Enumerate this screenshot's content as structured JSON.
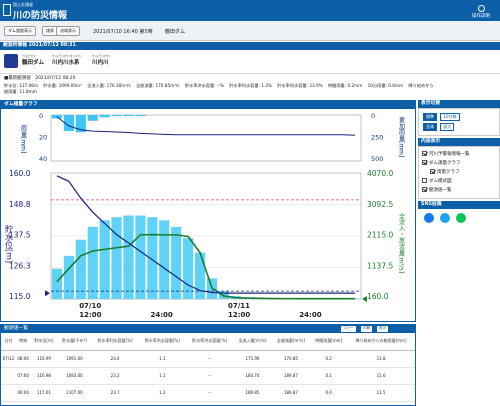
{
  "header": {
    "subtitle": "国土交通省",
    "title": "川の防災情報",
    "menu_label": "操作説明"
  },
  "toolbar": {
    "btn1": "ダム諸量表示",
    "btn2": "諸表",
    "btn3": "流域表示",
    "datetime": "2021/07/10 16:40 第5時",
    "dam_name": "鶴田ダム"
  },
  "observatory": {
    "bar_label": "観測所情報 2021/07/12 08:31",
    "refresh_icon": "refresh-icon",
    "dam_kana": "つるだだむ",
    "dam": "鶴田ダム",
    "river_kana": "せんだいがわすいけい",
    "river_system": "川内川水系",
    "river2_kana": "せんだいがわ",
    "river": "川内川"
  },
  "latest": {
    "label": "■最新観測値",
    "time": "2021/07/12 08:20"
  },
  "stats": [
    "貯水位: 117.06m",
    "貯水量: 1099.00m³",
    "全流入量: 176.30m³/s",
    "全放流量: 170.85m³/s",
    "貯水率洪水容量: --%",
    "貯水率利水容量: 1.3%",
    "貯水率利水容量: 23.9%",
    "時間雨量: 0.2mm",
    "10分雨量: 0.0mm",
    "降り始めから",
    "総雨量: 11.8mm"
  ],
  "chart": {
    "bar_label": "ダム諸量グラフ",
    "rain_axis_label": "雨量[mm]",
    "cum_axis_label": "累加雨量[mm]",
    "level_axis_label": "貯水位[m]",
    "flow_axis_label": "全流入・放流量[m³/s]",
    "rain_ticks": [
      "0",
      "20",
      "40"
    ],
    "cum_ticks": [
      "0",
      "250",
      "500"
    ],
    "level_ticks": [
      "160.0",
      "148.8",
      "137.5",
      "126.3",
      "115.0"
    ],
    "flow_ticks": [
      "4070.0",
      "3092.5",
      "2115.0",
      "1137.5",
      "160.0"
    ],
    "x_day1": "07/10",
    "x_day2": "07/11",
    "x_labels": [
      "12:00",
      "24:00",
      "12:00",
      "24:00"
    ],
    "colors": {
      "rain": "#3dc6f5",
      "inflow_bars": "#5fd3f7",
      "level": "#1a237e",
      "outflow": "#1b7d2e",
      "flood_line": "#e040a0",
      "normal_line": "#1a237e"
    }
  },
  "chart_data": {
    "type": "bar",
    "x": [
      "07/10 06:00",
      "07/10 08:00",
      "07/10 10:00",
      "07/10 12:00",
      "07/10 14:00",
      "07/10 16:00",
      "07/10 18:00",
      "07/10 20:00",
      "07/10 22:00",
      "07/11 00:00",
      "07/11 02:00",
      "07/11 04:00",
      "07/11 06:00",
      "07/11 08:00",
      "07/11 10:00",
      "07/11 12:00",
      "07/11 14:00",
      "07/11 16:00",
      "07/11 18:00",
      "07/11 20:00",
      "07/11 22:00",
      "07/12 00:00",
      "07/12 02:00",
      "07/12 04:00",
      "07/12 06:00",
      "07/12 08:00"
    ],
    "series": [
      {
        "name": "貯水位",
        "values": [
          159,
          157,
          151,
          146,
          142,
          138,
          135,
          132,
          129,
          126,
          123,
          120,
          118,
          117.3,
          117.1,
          117.1,
          117.1,
          117.1,
          117.1,
          117.1,
          117.1,
          117.1,
          117.1,
          117.1,
          117.1,
          117.06
        ]
      },
      {
        "name": "全流入量",
        "values": [
          1100,
          1500,
          2000,
          2400,
          2600,
          2700,
          2750,
          2750,
          2700,
          2600,
          2400,
          2050,
          1600,
          800,
          400,
          250,
          200,
          190,
          185,
          180,
          178,
          177,
          176,
          176,
          176,
          176.3
        ]
      },
      {
        "name": "全放流量",
        "values": [
          700,
          1100,
          1500,
          1650,
          1700,
          1750,
          1800,
          2150,
          2160,
          2150,
          2150,
          2100,
          1600,
          500,
          250,
          200,
          190,
          180,
          175,
          172,
          171,
          171,
          171,
          171,
          171,
          170.85
        ]
      }
    ],
    "rain_hourly": [
      3,
      14,
      15,
      5,
      2,
      1,
      1,
      1,
      0,
      0,
      0,
      0,
      0,
      0,
      0,
      0,
      0,
      0,
      0,
      0,
      0,
      0,
      0,
      0,
      0,
      0.2
    ],
    "cumulative_rain": [
      20,
      120,
      160,
      175,
      180,
      185,
      190,
      200,
      205,
      210,
      215,
      215,
      215,
      215,
      215,
      215,
      215,
      215,
      215,
      215,
      215,
      215,
      215,
      215,
      215,
      220
    ],
    "ylim_level": [
      115,
      160
    ],
    "ylim_flow": [
      160,
      4070
    ],
    "ylim_rain": [
      0,
      40
    ],
    "ylim_cum": [
      0,
      500
    ],
    "flood_level": 150.4,
    "normal_level": 117.1
  },
  "sidebar": {
    "switch_label": "表示切替",
    "switch_chips": [
      "標準",
      "10分毎"
    ],
    "size_chips": [
      "全体",
      "拡大"
    ],
    "content_label": "内容表示",
    "items": [
      {
        "label": "河川予警報情報一覧",
        "checked": true
      },
      {
        "label": "ダム諸量グラフ",
        "checked": true
      },
      {
        "label": "雨量グラフ",
        "checked": true,
        "indent": true
      },
      {
        "label": "ダム模式図",
        "checked": false
      },
      {
        "label": "観測値一覧",
        "checked": true
      }
    ],
    "sns_label": "SNS投稿",
    "sns_colors": [
      "#1877f2",
      "#1da1f2",
      "#06c755"
    ]
  },
  "table": {
    "bar_label": "観測値一覧",
    "btns": [
      "コピー",
      "印刷",
      "表示"
    ],
    "headers": [
      "日付",
      "時刻",
      "貯水位[m]",
      "貯水量[千m³]",
      "貯水率利水容量[%]",
      "貯水率洪水容量[%]",
      "貯水率洪水容量[%]",
      "全流入量[m³/s]",
      "全放流量[m³/s]",
      "時間雨量[mm]",
      "降り始めからの総雨量[mm]"
    ],
    "rows": [
      [
        "07/12",
        "08:00",
        "116.99",
        "1091.00",
        "23.4",
        "1.1",
        "--",
        "175.99",
        "170.85",
        "0.2",
        "11.8"
      ],
      [
        "",
        "07:00",
        "116.98",
        "1083.00",
        "23.2",
        "1.1",
        "--",
        "184.74",
        "189.87",
        "0.1",
        "11.6"
      ],
      [
        "",
        "06:00",
        "117.01",
        "1107.00",
        "23.7",
        "1.2",
        "--",
        "189.85",
        "189.87",
        "0.0",
        "11.5"
      ]
    ]
  }
}
